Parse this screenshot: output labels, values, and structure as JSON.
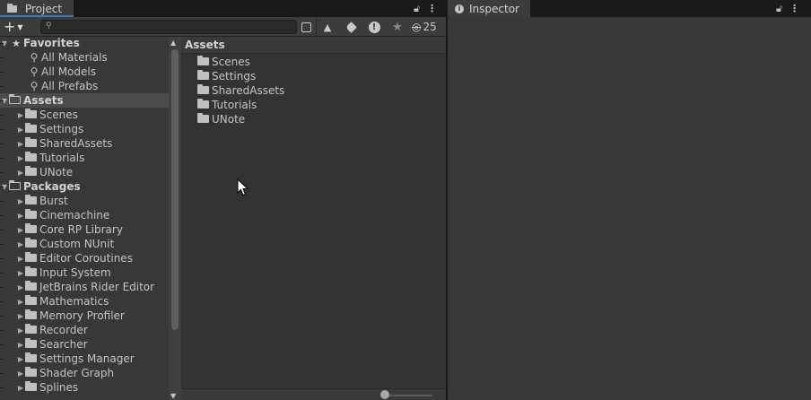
{
  "project_tab": {
    "title": "Project",
    "icon": "folder-icon"
  },
  "inspector_tab": {
    "title": "Inspector",
    "icon": "info-icon"
  },
  "toolbar": {
    "create_icon": "plus-icon",
    "search_placeholder": "",
    "search_value": "",
    "hidden_count": "25"
  },
  "tree": {
    "favorites": {
      "label": "Favorites",
      "items": [
        {
          "label": "All Materials"
        },
        {
          "label": "All Models"
        },
        {
          "label": "All Prefabs"
        }
      ]
    },
    "assets": {
      "label": "Assets",
      "items": [
        {
          "label": "Scenes"
        },
        {
          "label": "Settings"
        },
        {
          "label": "SharedAssets"
        },
        {
          "label": "Tutorials"
        },
        {
          "label": "UNote"
        }
      ]
    },
    "packages": {
      "label": "Packages",
      "items": [
        {
          "label": "Burst"
        },
        {
          "label": "Cinemachine"
        },
        {
          "label": "Core RP Library"
        },
        {
          "label": "Custom NUnit"
        },
        {
          "label": "Editor Coroutines"
        },
        {
          "label": "Input System"
        },
        {
          "label": "JetBrains Rider Editor"
        },
        {
          "label": "Mathematics"
        },
        {
          "label": "Memory Profiler"
        },
        {
          "label": "Recorder"
        },
        {
          "label": "Searcher"
        },
        {
          "label": "Settings Manager"
        },
        {
          "label": "Shader Graph"
        },
        {
          "label": "Splines"
        }
      ]
    }
  },
  "assets_pane": {
    "header": "Assets",
    "items": [
      {
        "label": "Scenes"
      },
      {
        "label": "Settings"
      },
      {
        "label": "SharedAssets"
      },
      {
        "label": "Tutorials"
      },
      {
        "label": "UNote"
      }
    ]
  }
}
